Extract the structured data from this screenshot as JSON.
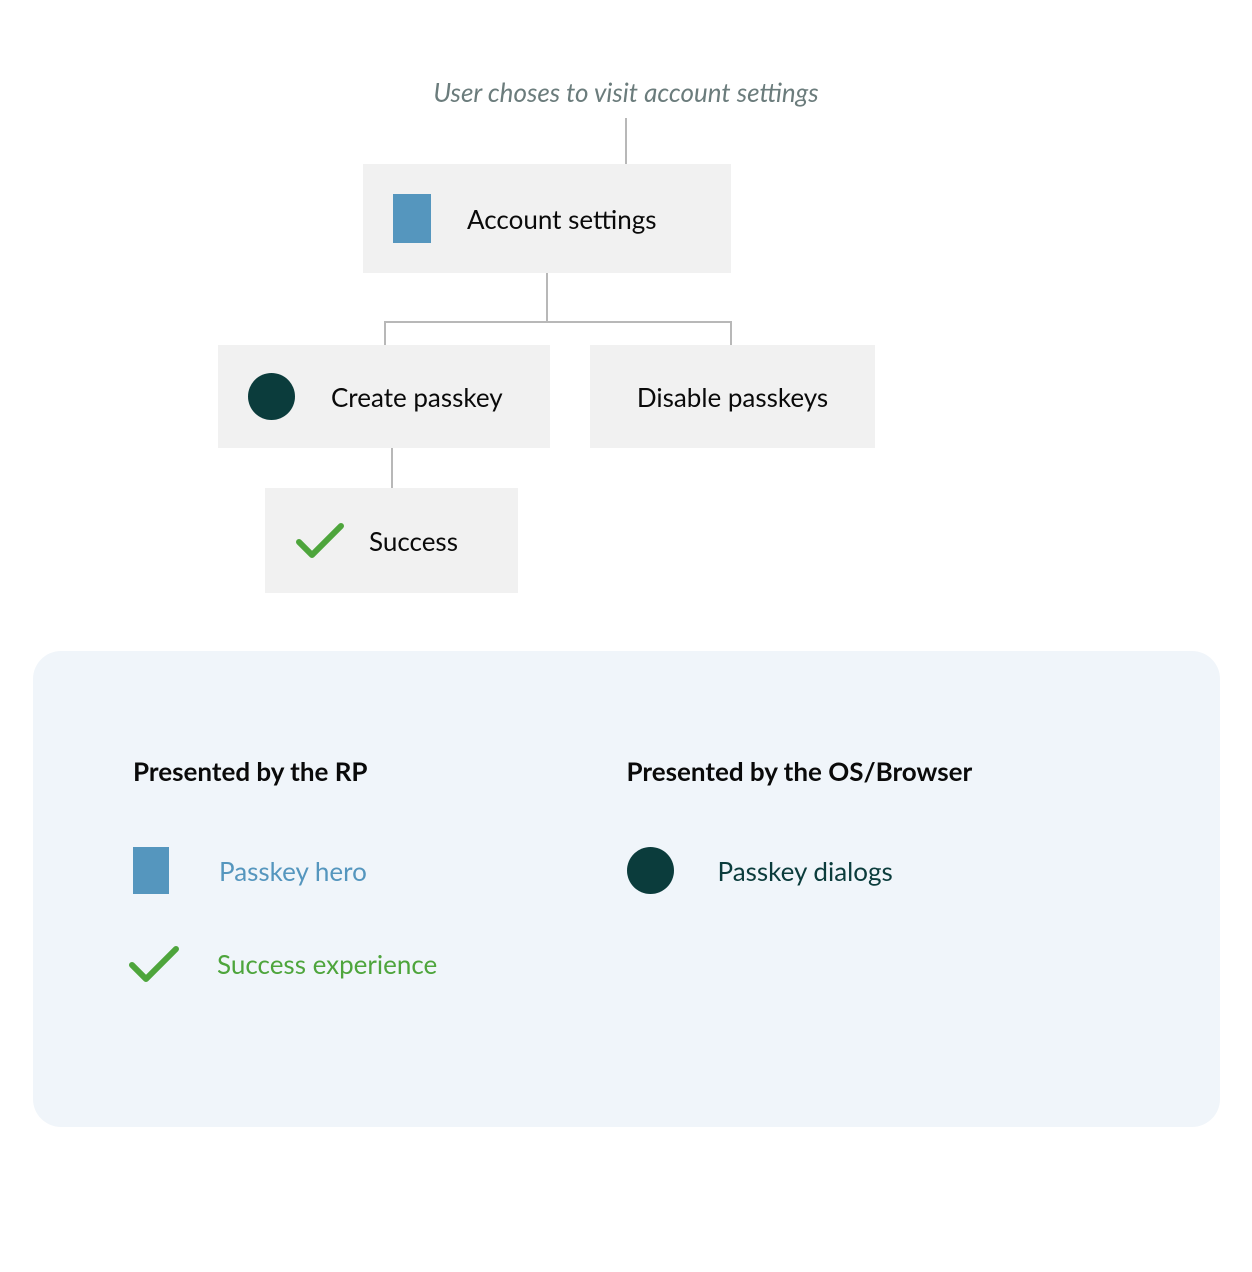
{
  "caption": "User choses to visit account settings",
  "nodes": {
    "account": "Account settings",
    "create": "Create passkey",
    "disable": "Disable passkeys",
    "success": "Success"
  },
  "legend": {
    "rp": {
      "heading": "Presented by the RP",
      "hero": "Passkey hero",
      "success": "Success experience"
    },
    "os": {
      "heading": "Presented by the OS/Browser",
      "dialogs": "Passkey dialogs"
    }
  },
  "colors": {
    "blue": "#5596be",
    "teal": "#0b3c3c",
    "green": "#4ea53c",
    "panel": "#f0f5fa",
    "node": "#f1f1f1"
  }
}
